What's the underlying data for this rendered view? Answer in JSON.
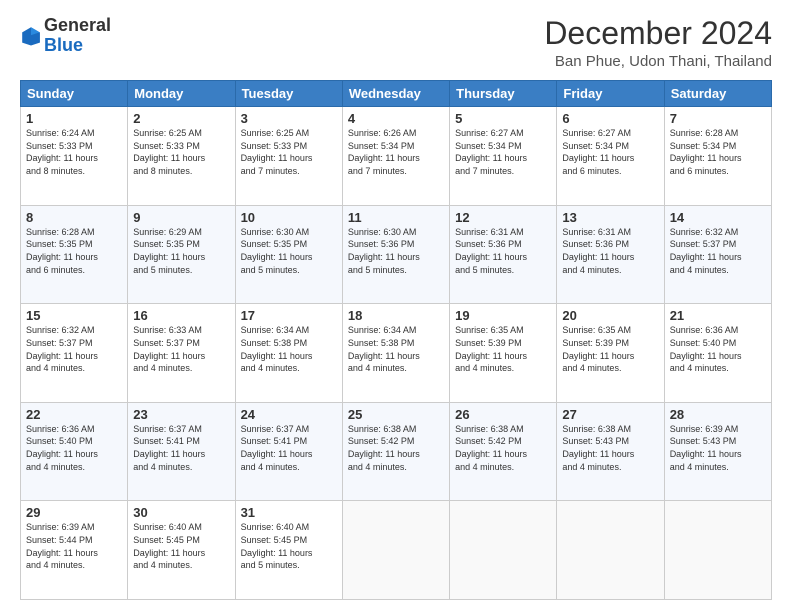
{
  "header": {
    "logo_general": "General",
    "logo_blue": "Blue",
    "main_title": "December 2024",
    "subtitle": "Ban Phue, Udon Thani, Thailand"
  },
  "calendar": {
    "days_of_week": [
      "Sunday",
      "Monday",
      "Tuesday",
      "Wednesday",
      "Thursday",
      "Friday",
      "Saturday"
    ],
    "weeks": [
      [
        {
          "day": "1",
          "info": "Sunrise: 6:24 AM\nSunset: 5:33 PM\nDaylight: 11 hours\nand 8 minutes."
        },
        {
          "day": "2",
          "info": "Sunrise: 6:25 AM\nSunset: 5:33 PM\nDaylight: 11 hours\nand 8 minutes."
        },
        {
          "day": "3",
          "info": "Sunrise: 6:25 AM\nSunset: 5:33 PM\nDaylight: 11 hours\nand 7 minutes."
        },
        {
          "day": "4",
          "info": "Sunrise: 6:26 AM\nSunset: 5:34 PM\nDaylight: 11 hours\nand 7 minutes."
        },
        {
          "day": "5",
          "info": "Sunrise: 6:27 AM\nSunset: 5:34 PM\nDaylight: 11 hours\nand 7 minutes."
        },
        {
          "day": "6",
          "info": "Sunrise: 6:27 AM\nSunset: 5:34 PM\nDaylight: 11 hours\nand 6 minutes."
        },
        {
          "day": "7",
          "info": "Sunrise: 6:28 AM\nSunset: 5:34 PM\nDaylight: 11 hours\nand 6 minutes."
        }
      ],
      [
        {
          "day": "8",
          "info": "Sunrise: 6:28 AM\nSunset: 5:35 PM\nDaylight: 11 hours\nand 6 minutes."
        },
        {
          "day": "9",
          "info": "Sunrise: 6:29 AM\nSunset: 5:35 PM\nDaylight: 11 hours\nand 5 minutes."
        },
        {
          "day": "10",
          "info": "Sunrise: 6:30 AM\nSunset: 5:35 PM\nDaylight: 11 hours\nand 5 minutes."
        },
        {
          "day": "11",
          "info": "Sunrise: 6:30 AM\nSunset: 5:36 PM\nDaylight: 11 hours\nand 5 minutes."
        },
        {
          "day": "12",
          "info": "Sunrise: 6:31 AM\nSunset: 5:36 PM\nDaylight: 11 hours\nand 5 minutes."
        },
        {
          "day": "13",
          "info": "Sunrise: 6:31 AM\nSunset: 5:36 PM\nDaylight: 11 hours\nand 4 minutes."
        },
        {
          "day": "14",
          "info": "Sunrise: 6:32 AM\nSunset: 5:37 PM\nDaylight: 11 hours\nand 4 minutes."
        }
      ],
      [
        {
          "day": "15",
          "info": "Sunrise: 6:32 AM\nSunset: 5:37 PM\nDaylight: 11 hours\nand 4 minutes."
        },
        {
          "day": "16",
          "info": "Sunrise: 6:33 AM\nSunset: 5:37 PM\nDaylight: 11 hours\nand 4 minutes."
        },
        {
          "day": "17",
          "info": "Sunrise: 6:34 AM\nSunset: 5:38 PM\nDaylight: 11 hours\nand 4 minutes."
        },
        {
          "day": "18",
          "info": "Sunrise: 6:34 AM\nSunset: 5:38 PM\nDaylight: 11 hours\nand 4 minutes."
        },
        {
          "day": "19",
          "info": "Sunrise: 6:35 AM\nSunset: 5:39 PM\nDaylight: 11 hours\nand 4 minutes."
        },
        {
          "day": "20",
          "info": "Sunrise: 6:35 AM\nSunset: 5:39 PM\nDaylight: 11 hours\nand 4 minutes."
        },
        {
          "day": "21",
          "info": "Sunrise: 6:36 AM\nSunset: 5:40 PM\nDaylight: 11 hours\nand 4 minutes."
        }
      ],
      [
        {
          "day": "22",
          "info": "Sunrise: 6:36 AM\nSunset: 5:40 PM\nDaylight: 11 hours\nand 4 minutes."
        },
        {
          "day": "23",
          "info": "Sunrise: 6:37 AM\nSunset: 5:41 PM\nDaylight: 11 hours\nand 4 minutes."
        },
        {
          "day": "24",
          "info": "Sunrise: 6:37 AM\nSunset: 5:41 PM\nDaylight: 11 hours\nand 4 minutes."
        },
        {
          "day": "25",
          "info": "Sunrise: 6:38 AM\nSunset: 5:42 PM\nDaylight: 11 hours\nand 4 minutes."
        },
        {
          "day": "26",
          "info": "Sunrise: 6:38 AM\nSunset: 5:42 PM\nDaylight: 11 hours\nand 4 minutes."
        },
        {
          "day": "27",
          "info": "Sunrise: 6:38 AM\nSunset: 5:43 PM\nDaylight: 11 hours\nand 4 minutes."
        },
        {
          "day": "28",
          "info": "Sunrise: 6:39 AM\nSunset: 5:43 PM\nDaylight: 11 hours\nand 4 minutes."
        }
      ],
      [
        {
          "day": "29",
          "info": "Sunrise: 6:39 AM\nSunset: 5:44 PM\nDaylight: 11 hours\nand 4 minutes."
        },
        {
          "day": "30",
          "info": "Sunrise: 6:40 AM\nSunset: 5:45 PM\nDaylight: 11 hours\nand 4 minutes."
        },
        {
          "day": "31",
          "info": "Sunrise: 6:40 AM\nSunset: 5:45 PM\nDaylight: 11 hours\nand 5 minutes."
        },
        {
          "day": "",
          "info": ""
        },
        {
          "day": "",
          "info": ""
        },
        {
          "day": "",
          "info": ""
        },
        {
          "day": "",
          "info": ""
        }
      ]
    ]
  }
}
